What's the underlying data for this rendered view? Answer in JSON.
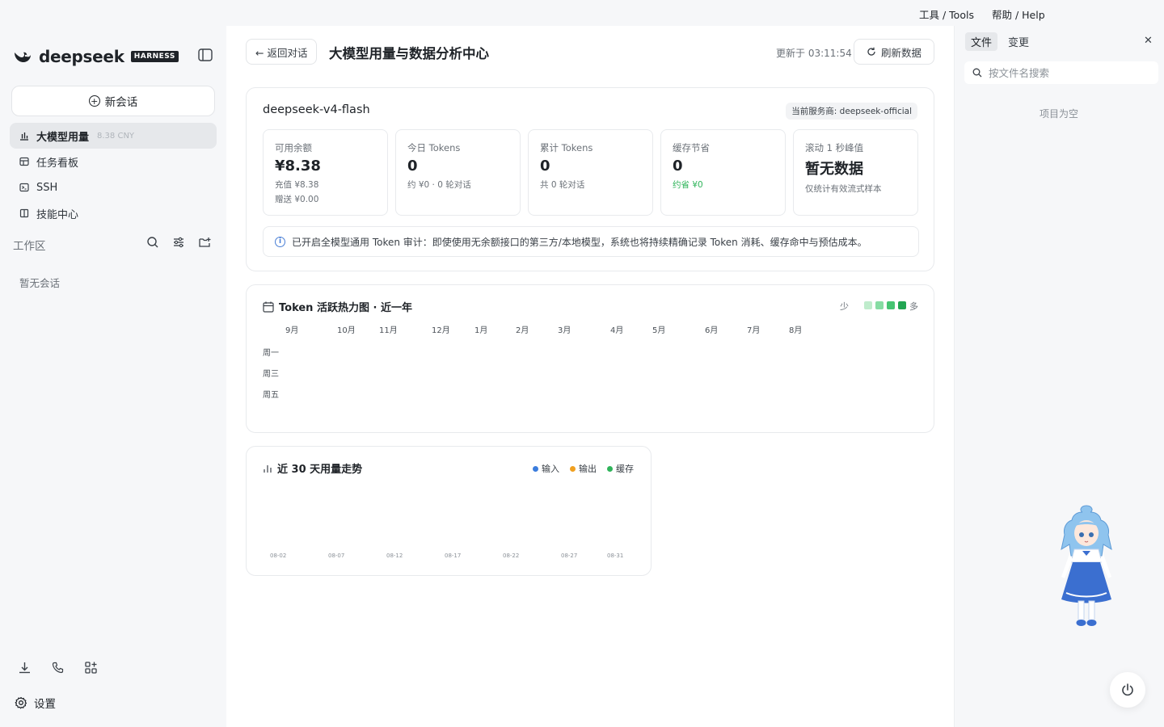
{
  "menubar": {
    "tools": "工具 / Tools",
    "help": "帮助 / Help"
  },
  "sidebar": {
    "logo_text": "deepseek",
    "logo_badge": "HARNESS",
    "new_chat": "新会话",
    "items": [
      {
        "label": "大模型用量",
        "sub": "8.38 CNY",
        "icon": "bar-chart-icon"
      },
      {
        "label": "任务看板",
        "icon": "kanban-icon"
      },
      {
        "label": "SSH",
        "icon": "terminal-icon"
      },
      {
        "label": "技能中心",
        "icon": "book-icon"
      }
    ],
    "workspace_label": "工作区",
    "empty_sessions": "暂无会话",
    "settings": "设置"
  },
  "main": {
    "back": "← 返回对话",
    "title": "大模型用量与数据分析中心",
    "updated": "更新于 03:11:54",
    "refresh": "刷新数据",
    "overview": {
      "model": "deepseek-v4-flash",
      "provider": "当前服务商: deepseek-official",
      "stats": [
        {
          "label": "可用余额",
          "value": "¥8.38",
          "line2": "充值 ¥8.38",
          "line3": "赠送 ¥0.00"
        },
        {
          "label": "今日 Tokens",
          "value": "0",
          "line2": "约 ¥0 · 0 轮对话"
        },
        {
          "label": "累计 Tokens",
          "value": "0",
          "line2": "共 0 轮对话"
        },
        {
          "label": "缓存节省",
          "value": "0",
          "line2": "约省 ¥0"
        },
        {
          "label": "滚动 1 秒峰值",
          "value": "暂无数据",
          "line2": "仅统计有效流式样本"
        }
      ],
      "notice": "已开启全模型通用 Token 审计：即使使用无余额接口的第三方/本地模型，系统也将持续精确记录 Token 消耗、缓存命中与预估成本。"
    },
    "heatmap": {
      "title": "Token 活跃热力图 · 近一年",
      "legend_less": "少",
      "legend_more": "多",
      "legend_colors": [
        "#bfeccc",
        "#86dca3",
        "#46c472",
        "#22a552"
      ],
      "months": [
        "9月",
        "10月",
        "11月",
        "12月",
        "1月",
        "2月",
        "3月",
        "4月",
        "5月",
        "6月",
        "7月",
        "8月"
      ],
      "weekdays": [
        "周一",
        "周三",
        "周五"
      ]
    },
    "trend": {
      "title": "近 30 天用量走势",
      "legend": [
        {
          "name": "输入",
          "color": "#3b7ddd"
        },
        {
          "name": "输出",
          "color": "#f0a020"
        },
        {
          "name": "缓存",
          "color": "#2fb45a"
        }
      ],
      "xticks": [
        "08-02",
        "08-07",
        "08-12",
        "08-17",
        "08-22",
        "08-27",
        "08-31"
      ]
    }
  },
  "rightpanel": {
    "tabs": [
      "文件",
      "变更"
    ],
    "search_placeholder": "按文件名搜索",
    "empty": "项目为空"
  }
}
